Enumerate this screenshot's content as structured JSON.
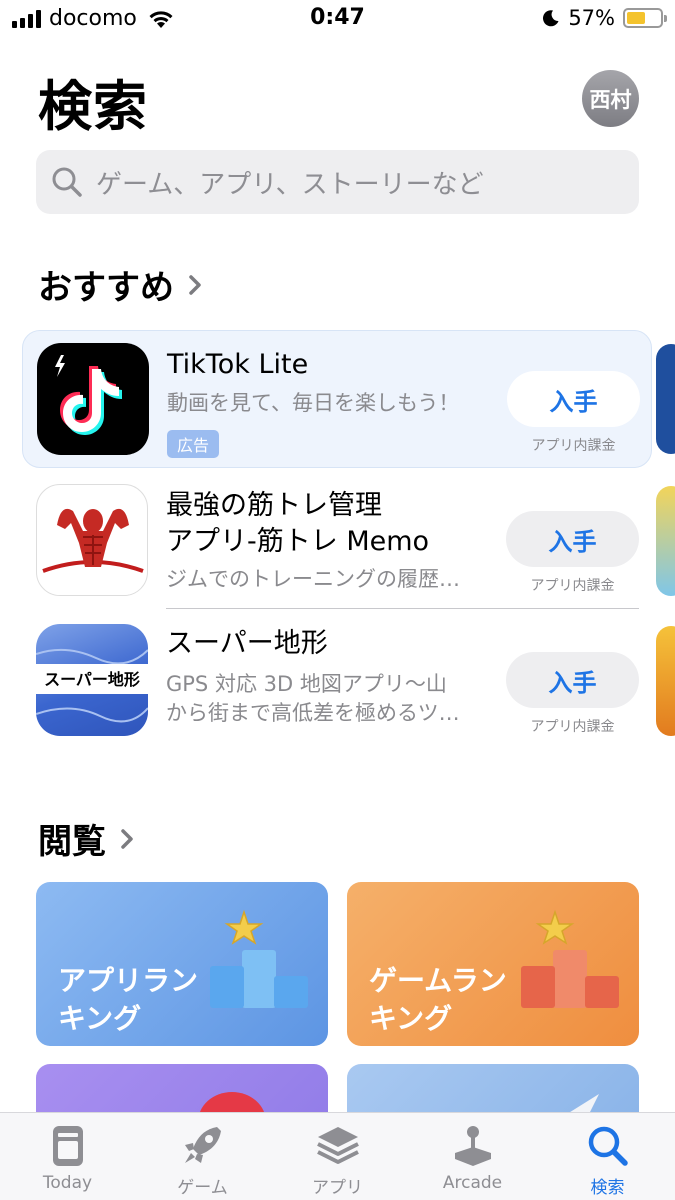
{
  "status_bar": {
    "carrier": "docomo",
    "time": "0:47",
    "battery": "57%",
    "battery_level": 0.57
  },
  "header": {
    "title": "検索",
    "avatar_text": "西村"
  },
  "search": {
    "placeholder": "ゲーム、アプリ、ストーリーなど"
  },
  "recommended": {
    "title": "おすすめ",
    "apps": [
      {
        "name": "TikTok Lite",
        "subtitle": "動画を見て、毎日を楽しもう！",
        "badge": "広告",
        "button": "入手",
        "iap": "アプリ内課金"
      },
      {
        "name_line1": "最強の筋トレ管理",
        "name_line2": "アプリ-筋トレ Memo",
        "subtitle": "ジムでのトレーニングの履歴…",
        "button": "入手",
        "iap": "アプリ内課金"
      },
      {
        "name": "スーパー地形",
        "subtitle_line1": "GPS 対応 3D 地図アプリ〜山",
        "subtitle_line2": "から街まで高低差を極めるツ…",
        "icon_text": "スーパー地形",
        "button": "入手",
        "iap": "アプリ内課金"
      }
    ]
  },
  "browse": {
    "title": "閲覧",
    "tiles": [
      {
        "line1": "アプリラン",
        "line2": "キング",
        "color": "#6fa5ea"
      },
      {
        "line1": "ゲームラン",
        "line2": "キング",
        "color": "#f29a4c"
      }
    ]
  },
  "tabbar": {
    "tabs": [
      {
        "label": "Today",
        "icon": "today-icon"
      },
      {
        "label": "ゲーム",
        "icon": "rocket-icon"
      },
      {
        "label": "アプリ",
        "icon": "layers-icon"
      },
      {
        "label": "Arcade",
        "icon": "joystick-icon"
      },
      {
        "label": "検索",
        "icon": "search-icon",
        "active": true
      }
    ]
  },
  "colors": {
    "accent": "#1e74e5",
    "search_bg": "#eeeef0",
    "ad_bg": "#eef4fd"
  }
}
